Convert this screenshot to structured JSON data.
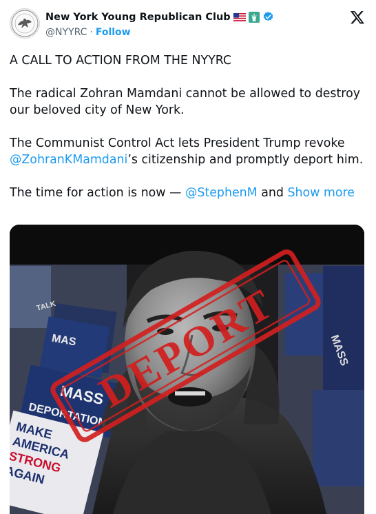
{
  "tweet": {
    "display_name": "New York Young Republican Club",
    "handle": "@NYYRC",
    "separator": "·",
    "follow_label": "Follow",
    "paragraphs": {
      "p1": "A CALL TO ACTION FROM THE NYYRC",
      "p2": "The radical Zohran Mamdani cannot be allowed to destroy our beloved city of New York.",
      "p3_before": "The Communist Control Act lets President Trump revoke ",
      "p3_mention": "@ZohranKMamdani",
      "p3_after": "’s citizenship and promptly deport him.",
      "p4_before": "The time for action is now — ",
      "p4_mention": "@StephenM",
      "p4_and": " and ",
      "show_more": "Show more"
    },
    "icons": {
      "flag": "us-flag-icon",
      "emoji": "statue-of-liberty-icon",
      "badge": "verified-badge-icon",
      "platform": "x-logo-icon"
    }
  },
  "image": {
    "stamp_text": "DEPORT",
    "sign_texts": {
      "mass": "MASS",
      "deportation": "DEPORTATION",
      "make": "MAKE",
      "america": "AMERICA",
      "strong": "STRONG",
      "again": "AGAIN",
      "small_sign": "MAS",
      "small_sign2": "MASS",
      "talk": "TALK"
    }
  },
  "colors": {
    "accent": "#1d9bf0",
    "text": "#0f1419",
    "muted": "#536471",
    "stamp": "#d21f1f"
  }
}
